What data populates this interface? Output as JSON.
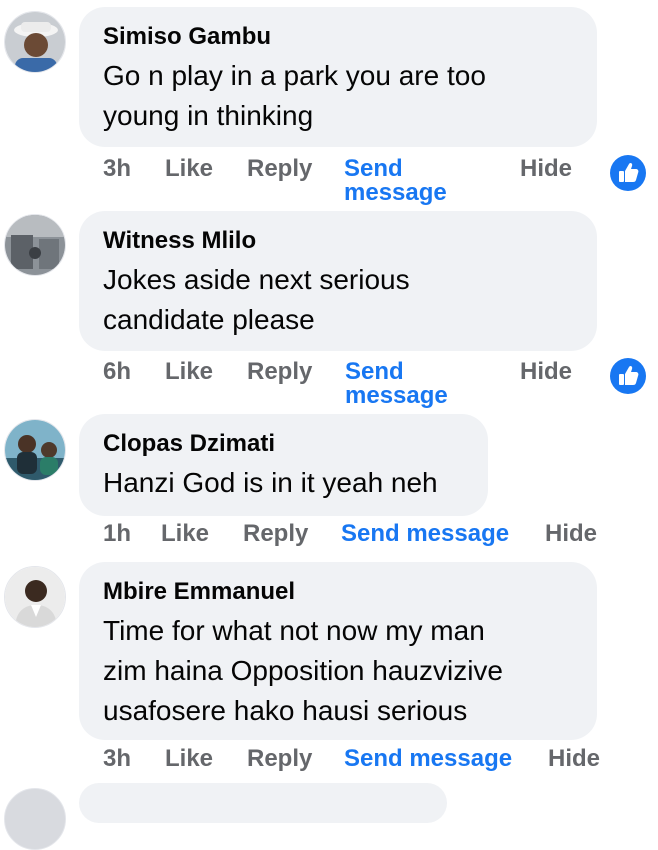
{
  "comments": [
    {
      "author": "Simiso Gambu",
      "text_lines": [
        "Go n play in a park you are too",
        "young in thinking"
      ],
      "time": "3h",
      "like": "Like",
      "reply": "Reply",
      "send_lines": [
        "Send",
        "message"
      ],
      "hide": "Hide",
      "has_like_badge": true
    },
    {
      "author": "Witness Mlilo",
      "text_lines": [
        "Jokes aside next serious",
        "candidate please"
      ],
      "time": "6h",
      "like": "Like",
      "reply": "Reply",
      "send_lines": [
        "Send",
        "message"
      ],
      "hide": "Hide",
      "has_like_badge": true
    },
    {
      "author": "Clopas Dzimati",
      "text_lines": [
        "Hanzi God is in it yeah neh"
      ],
      "time": "1h",
      "like": "Like",
      "reply": "Reply",
      "send": "Send message",
      "hide": "Hide",
      "has_like_badge": false
    },
    {
      "author": "Mbire Emmanuel",
      "text_lines": [
        "Time for what not now my man",
        "zim haina Opposition hauzvizive",
        "usafosere hako hausi serious"
      ],
      "time": "3h",
      "like": "Like",
      "reply": "Reply",
      "send": "Send message",
      "hide": "Hide",
      "has_like_badge": false
    }
  ],
  "colors": {
    "bubble": "#f0f2f5",
    "link": "#1877f2",
    "meta": "#65676b",
    "badge": "#1877f2"
  },
  "icons": {
    "like_badge": "thumbs-up-icon"
  }
}
